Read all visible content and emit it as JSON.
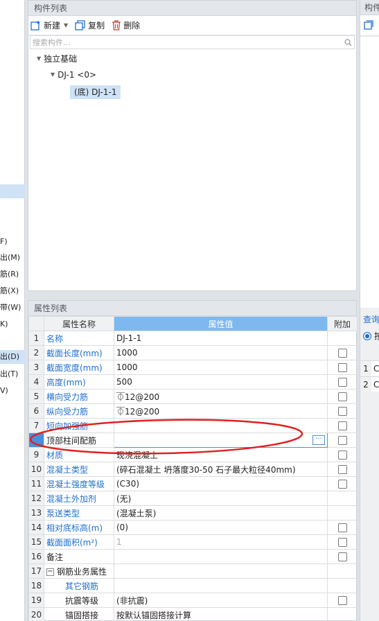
{
  "left_strip": {
    "items": [
      "F)",
      "出(M)",
      "筋(R)",
      "筋(X)",
      "带(W)",
      "K)",
      "出(D)",
      "出(T)",
      "V)"
    ]
  },
  "component_list": {
    "title": "构件列表",
    "toolbar": {
      "new_label": "新建",
      "copy_label": "复制",
      "delete_label": "删除"
    },
    "search_placeholder": "搜索构件...",
    "tree": {
      "root": "独立基础",
      "child": "DJ-1 <0>",
      "leaf": "(底) DJ-1-1"
    }
  },
  "property_list": {
    "title": "属性列表",
    "headers": {
      "name": "属性名称",
      "value": "属性值",
      "extra": "附加"
    },
    "rows": [
      {
        "num": "1",
        "name": "名称",
        "value": "DJ-1-1",
        "checkbox": false
      },
      {
        "num": "2",
        "name": "截面长度(mm)",
        "value": "1000",
        "checkbox": true
      },
      {
        "num": "3",
        "name": "截面宽度(mm)",
        "value": "1000",
        "checkbox": true
      },
      {
        "num": "4",
        "name": "高度(mm)",
        "value": "500",
        "checkbox": true
      },
      {
        "num": "5",
        "name": "横向受力筋",
        "value": "⏁12@200",
        "checkbox": true
      },
      {
        "num": "6",
        "name": "纵向受力筋",
        "value": "⏁12@200",
        "checkbox": true
      },
      {
        "num": "7",
        "name": "短向加强筋",
        "value": "",
        "checkbox": true
      },
      {
        "num": "8",
        "name": "顶部柱间配筋",
        "value": "",
        "checkbox": true
      },
      {
        "num": "9",
        "name": "材质",
        "value": "现浇混凝土",
        "checkbox": true
      },
      {
        "num": "10",
        "name": "混凝土类型",
        "value": "(碎石混凝土 坍落度30-50 石子最大粒径40mm)",
        "checkbox": true
      },
      {
        "num": "11",
        "name": "混凝土强度等级",
        "value": "(C30)",
        "checkbox": true
      },
      {
        "num": "12",
        "name": "混凝土外加剂",
        "value": "(无)",
        "checkbox": false
      },
      {
        "num": "13",
        "name": "泵送类型",
        "value": "(混凝土泵)",
        "checkbox": false
      },
      {
        "num": "14",
        "name": "相对底标高(m)",
        "value": "(0)",
        "checkbox": true
      },
      {
        "num": "15",
        "name": "截面面积(m²)",
        "value": "1",
        "checkbox": true
      },
      {
        "num": "16",
        "name": "备注",
        "value": "",
        "checkbox": true
      },
      {
        "num": "17",
        "name": "钢筋业务属性",
        "value": "",
        "checkbox": false
      },
      {
        "num": "18",
        "name": "其它钢筋",
        "value": "",
        "checkbox": false
      },
      {
        "num": "19",
        "name": "抗震等级",
        "value": "(非抗震)",
        "checkbox": true
      },
      {
        "num": "20",
        "name": "锚固搭接",
        "value": "按默认锚固搭接计算",
        "checkbox": false
      }
    ],
    "group_toggle": "−"
  },
  "right_panel": {
    "title": "构件",
    "link": "查询",
    "radio_label": "按",
    "row_nums": [
      "1",
      "2"
    ],
    "row_vals": [
      "C",
      "C"
    ]
  },
  "colors": {
    "accent": "#7fb8ee",
    "link_blue": "#1e6fd0",
    "annotation_red": "#e0201e"
  }
}
